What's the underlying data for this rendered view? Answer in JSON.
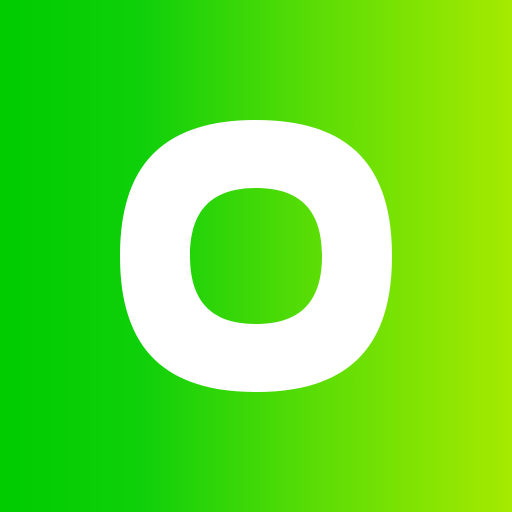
{
  "logo": {
    "icon": "ring-logo-icon",
    "colors": {
      "gradient_start": "#00CC00",
      "gradient_end": "#A6EA00",
      "ring": "#FFFFFF"
    }
  }
}
